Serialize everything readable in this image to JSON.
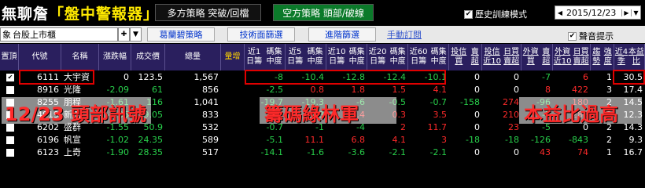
{
  "header": {
    "logo_main": "無聊詹",
    "logo_highlight": "「盤中警報器」",
    "tabs": [
      {
        "label": "多方策略  突破/回檔"
      },
      {
        "label": "空方策略  頭部/破線"
      }
    ],
    "history_checkbox": {
      "label": "歷史訓練模式",
      "checked": true
    },
    "date": "2015/12/23"
  },
  "filterbar": {
    "market_prefix": "象",
    "market_select": "台股上市櫃",
    "links": [
      "葛蘭碧策略",
      "技術面篩選",
      "進階篩選",
      "手動訂閱"
    ],
    "sound_checkbox": {
      "label": "聲音提示",
      "checked": true
    }
  },
  "columns": [
    "置頂",
    "代號",
    "名稱",
    "漲跌幅",
    "成交價",
    "總量",
    "量增",
    "近1日籌碼集中度",
    "近5日籌碼集中度",
    "近10日籌碼集中度",
    "近20日籌碼集中度",
    "近60日籌碼集中度",
    "投信買賣超",
    "投信近10日買賣超",
    "外資買賣超",
    "外資近10日買賣超",
    "趨勢強度",
    "近4季本益比"
  ],
  "column_lines": {
    "pin": [
      "置",
      "頂"
    ],
    "c1": [
      "近1日籌",
      "碼集中度"
    ],
    "c5": [
      "近5日籌",
      "碼集中度"
    ],
    "c10": [
      "近10日籌",
      "碼集中度"
    ],
    "c20": [
      "近20日籌",
      "碼集中度"
    ],
    "c60": [
      "近60日籌",
      "碼集中度"
    ],
    "it": [
      "投信買",
      "賣超"
    ],
    "it10": [
      "投信近10",
      "日買賣超"
    ],
    "fi": [
      "外資買",
      "賣超"
    ],
    "fi10": [
      "外資近10",
      "日買賣超"
    ],
    "trend": [
      "趨勢",
      "強度"
    ],
    "pe": [
      "近4季",
      "本益比"
    ]
  },
  "rows": [
    {
      "code": "6111",
      "name": "大宇資",
      "chg": "0",
      "price": "123.5",
      "vol": "1,567",
      "c1": "-8",
      "c5": "-10.4",
      "c10": "-12.8",
      "c20": "-12.4",
      "c60": "-10.1",
      "it": "0",
      "it10": "0",
      "fi": "-7",
      "fi10": "6",
      "trend": "1",
      "pe": "30.5",
      "checked": true
    },
    {
      "code": "8916",
      "name": "光隆",
      "chg": "-2.09",
      "price": "61",
      "vol": "856",
      "c1": "-2.5",
      "c5": "0.8",
      "c10": "1.8",
      "c20": "1.5",
      "c60": "4.1",
      "it": "0",
      "it10": "0",
      "fi": "8",
      "fi10": "422",
      "trend": "3",
      "pe": "17.4",
      "checked": false
    },
    {
      "code": "8255",
      "name": "朋程",
      "chg": "-1.61",
      "price": "116",
      "vol": "1,041",
      "c1": "-19.7",
      "c5": "-19.3",
      "c10": "-6",
      "c20": "-0.5",
      "c60": "-0.7",
      "it": "-158",
      "it10": "274",
      "fi": "-96",
      "fi10": "180",
      "trend": "2",
      "pe": "14.5",
      "checked": false
    },
    {
      "code": "4919",
      "name": "新唐",
      "chg": "-1.36",
      "price": "29.05",
      "vol": "833",
      "c1": "-3.2",
      "c5": "-4.3",
      "c10": "1.4",
      "c20": "0.3",
      "c60": "3.5",
      "it": "0",
      "it10": "210",
      "fi": "-7",
      "fi10": "288",
      "trend": "2",
      "pe": "12.3",
      "checked": false
    },
    {
      "code": "6202",
      "name": "盛群",
      "chg": "-1.55",
      "price": "50.9",
      "vol": "532",
      "c1": "-0.7",
      "c5": "-1",
      "c10": "-4",
      "c20": "2",
      "c60": "11.7",
      "it": "0",
      "it10": "23",
      "fi": "-5",
      "fi10": "0",
      "trend": "2",
      "pe": "14.3",
      "checked": false
    },
    {
      "code": "6196",
      "name": "帆宣",
      "chg": "-1.02",
      "price": "24.35",
      "vol": "589",
      "c1": "-5.1",
      "c5": "11.1",
      "c10": "6.8",
      "c20": "4.1",
      "c60": "3",
      "it": "-18",
      "it10": "-18",
      "fi": "-126",
      "fi10": "-843",
      "trend": "2",
      "pe": "9.3",
      "checked": false
    },
    {
      "code": "6123",
      "name": "上奇",
      "chg": "-1.90",
      "price": "28.35",
      "vol": "517",
      "c1": "-14.1",
      "c5": "-1.6",
      "c10": "-3.6",
      "c20": "-2.1",
      "c60": "-2.1",
      "it": "0",
      "it10": "0",
      "fi": "43",
      "fi10": "74",
      "trend": "1",
      "pe": "16.7",
      "checked": false
    }
  ],
  "annotations": [
    {
      "text": "12/23 頭部訊號"
    },
    {
      "text": "籌碼綠林軍"
    },
    {
      "text": "本益比過高"
    }
  ],
  "colors": {
    "header_bg": "#2a1f5e",
    "positive": "#ff2a2a",
    "negative": "#28d04b",
    "accent": "#ffd400",
    "annotation": "#e00000"
  }
}
